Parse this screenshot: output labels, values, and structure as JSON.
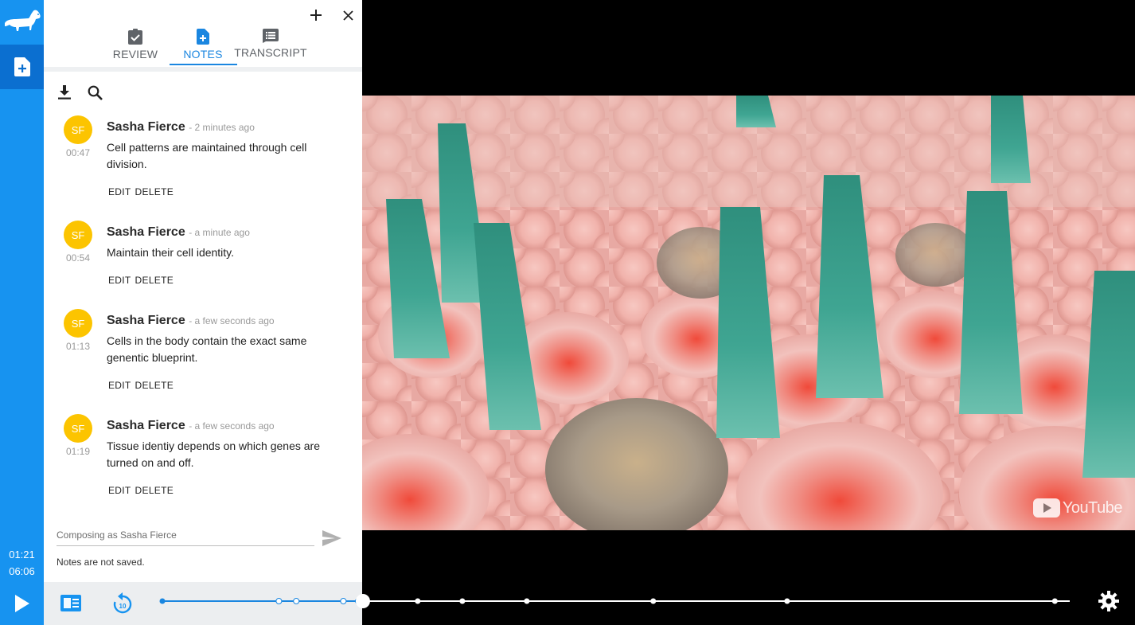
{
  "rail": {
    "logo_icon": "dachshund-logo-icon",
    "notes_icon": "note-add-icon",
    "current_time": "01:21",
    "duration": "06:06",
    "play_icon": "play-icon"
  },
  "panel": {
    "add_icon": "plus-icon",
    "close_icon": "close-icon",
    "tabs": [
      {
        "label": "REVIEW",
        "icon": "assignment-check-icon",
        "active": false
      },
      {
        "label": "NOTES",
        "icon": "note-add-icon",
        "active": true
      },
      {
        "label": "TRANSCRIPT",
        "icon": "transcript-icon",
        "active": false
      }
    ],
    "tools": {
      "download_icon": "download-icon",
      "search_icon": "search-icon"
    },
    "notes": [
      {
        "initials": "SF",
        "author": "Sasha Fierce",
        "when": "- 2 minutes ago",
        "timestamp": "00:47",
        "text": "Cell patterns are maintained through cell division.",
        "edit": "EDIT",
        "delete": "DELETE"
      },
      {
        "initials": "SF",
        "author": "Sasha Fierce",
        "when": "- a minute ago",
        "timestamp": "00:54",
        "text": "Maintain their cell identity.",
        "edit": "EDIT",
        "delete": "DELETE"
      },
      {
        "initials": "SF",
        "author": "Sasha Fierce",
        "when": "- a few seconds ago",
        "timestamp": "01:13",
        "text": "Cells in the body contain the exact same genentic blueprint.",
        "edit": "EDIT",
        "delete": "DELETE"
      },
      {
        "initials": "SF",
        "author": "Sasha Fierce",
        "when": "- a few seconds ago",
        "timestamp": "01:19",
        "text": "Tissue identiy depends on which genes are turned on and off.",
        "edit": "EDIT",
        "delete": "DELETE"
      }
    ],
    "compose_placeholder": "Composing as Sasha Fierce",
    "send_icon": "send-icon",
    "unsaved_text": "Notes are not saved."
  },
  "player": {
    "captions_icon": "captions-icon",
    "rewind_icon": "replay-10-icon",
    "settings_icon": "gear-icon",
    "youtube_text": "YouTube",
    "progress_fraction": 0.221,
    "note_markers_seconds": [
      47,
      54,
      73,
      79
    ],
    "other_markers_seconds": [
      0,
      103,
      121,
      147,
      198,
      252,
      360
    ],
    "current_seconds": 81,
    "duration_seconds": 366
  },
  "colors": {
    "rail": "#1793f0",
    "rail_active": "#0b6fd0",
    "accent": "#1a86e0",
    "avatar": "#fcc400"
  }
}
